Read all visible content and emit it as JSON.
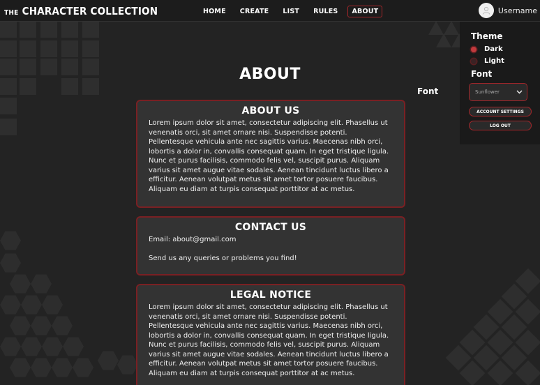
{
  "header": {
    "logo_prefix": "THE",
    "logo_main": "CHARACTER COLLECTION",
    "nav": [
      "HOME",
      "CREATE",
      "LIST",
      "RULES",
      "ABOUT"
    ],
    "active_nav": "ABOUT",
    "username": "Username"
  },
  "settings": {
    "theme_heading": "Theme",
    "theme_options": [
      "Dark",
      "Light"
    ],
    "theme_selected": "Dark",
    "font_heading": "Font",
    "font_value": "Sunflower",
    "account_settings": "ACCOUNT SETTINGS",
    "logout": "LOG OUT",
    "font_float_label": "Font"
  },
  "main": {
    "title": "ABOUT",
    "about_us": {
      "heading": "ABOUT US",
      "body": "Lorem ipsum dolor sit amet, consectetur adipiscing elit. Phasellus ut venenatis orci, sit amet ornare nisi. Suspendisse potenti. Pellentesque vehicula ante nec sagittis varius. Maecenas nibh orci, lobortis a dolor in, convallis consequat quam. In eget tristique ligula. Nunc et purus facilisis, commodo felis vel, suscipit purus. Aliquam varius sit amet augue vitae sodales. Aenean tincidunt luctus libero a efficitur. Aenean volutpat metus sit amet tortor posuere faucibus. Aliquam eu diam at turpis consequat porttitor at ac metus."
    },
    "contact": {
      "heading": "CONTACT US",
      "email": "Email: about@gmail.com",
      "note": "Send us any queries or problems you find!"
    },
    "legal": {
      "heading": "LEGAL NOTICE",
      "body": "Lorem ipsum dolor sit amet, consectetur adipiscing elit. Phasellus ut venenatis orci, sit amet ornare nisi. Suspendisse potenti. Pellentesque vehicula ante nec sagittis varius. Maecenas nibh orci, lobortis a dolor in, convallis consequat quam. In eget tristique ligula. Nunc et purus facilisis, commodo felis vel, suscipit purus. Aliquam varius sit amet augue vitae sodales. Aenean tincidunt luctus libero a efficitur. Aenean volutpat metus sit amet tortor posuere faucibus. Aliquam eu diam at turpis consequat porttitor at ac metus."
    }
  },
  "colors": {
    "background": "#232323",
    "accent": "#a3262a",
    "card": "#333333",
    "panel": "#1a1a1a"
  },
  "icons": {
    "avatar": "user-avatar-icon",
    "select": "chevron-down-icon"
  }
}
